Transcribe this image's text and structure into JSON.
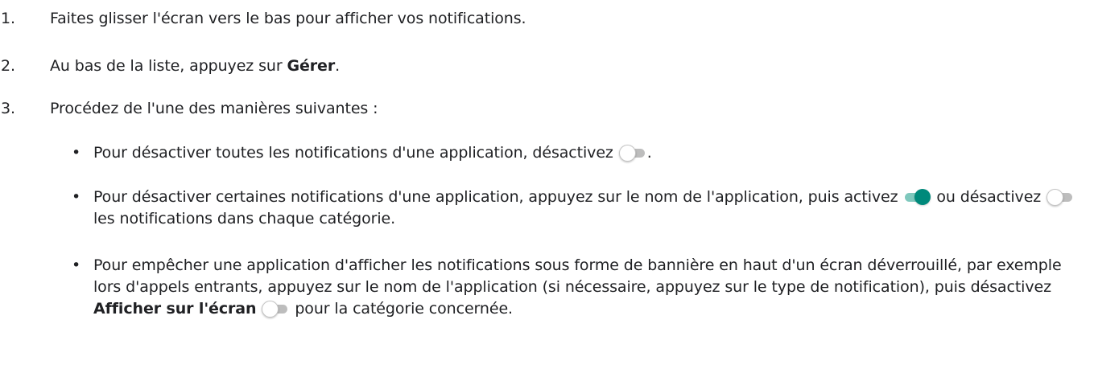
{
  "steps": [
    {
      "number": "1.",
      "text": "Faites glisser l'écran vers le bas pour afficher vos notifications."
    },
    {
      "number": "2.",
      "text_before": "Au bas de la liste, appuyez sur ",
      "bold": "Gérer",
      "text_after": "."
    },
    {
      "number": "3.",
      "text": "Procédez de l'une des manières suivantes :"
    }
  ],
  "bullet_symbol": "•",
  "bullets": [
    {
      "part1": "Pour désactiver toutes les notifications d'une application, désactivez ",
      "part2": "."
    },
    {
      "part1": "Pour désactiver certaines notifications d'une application, appuyez sur le nom de l'application, puis activez ",
      "part2": " ou désactivez ",
      "part3": " les notifications dans chaque catégorie."
    },
    {
      "part1": "Pour empêcher une application d'afficher les notifications sous forme de bannière en haut d'un écran déverrouillé, par exemple lors d'appels entrants, appuyez sur le nom de l'application (si nécessaire, appuyez sur le type de notification), puis désactivez ",
      "bold": "Afficher sur l'écran",
      "part2": " pour la catégorie concernée."
    }
  ],
  "icons": {
    "toggle_off": "toggle-off-icon",
    "toggle_on": "toggle-on-icon"
  },
  "colors": {
    "text": "#202124",
    "toggle_on_knob": "#00897b",
    "toggle_on_track": "#7fc8bd",
    "toggle_off_track": "#bdbdbd",
    "toggle_off_knob": "#ffffff"
  }
}
